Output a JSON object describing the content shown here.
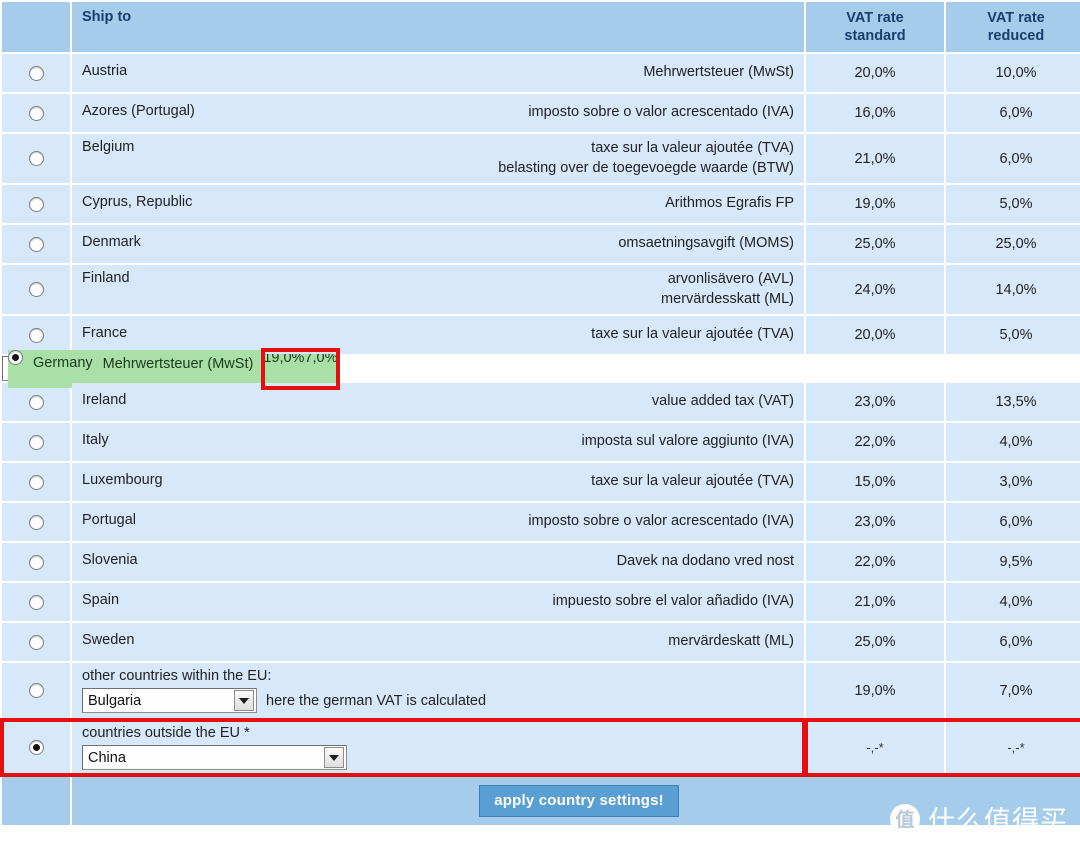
{
  "table": {
    "headers": {
      "radio_col": "",
      "ship_to": "Ship to",
      "vat_standard_line1": "VAT rate",
      "vat_standard_line2": "standard",
      "vat_reduced_line1": "VAT rate",
      "vat_reduced_line2": "reduced"
    },
    "rows": [
      {
        "country": "Austria",
        "tax_names": [
          "Mehrwertsteuer (MwSt)"
        ],
        "vat_standard": "20,0%",
        "vat_reduced": "10,0%",
        "selected": false
      },
      {
        "country": "Azores (Portugal)",
        "tax_names": [
          "imposto sobre o valor acrescentado (IVA)"
        ],
        "vat_standard": "16,0%",
        "vat_reduced": "6,0%",
        "selected": false
      },
      {
        "country": "Belgium",
        "tax_names": [
          "taxe sur la valeur ajoutée (TVA)",
          "belasting over de toegevoegde waarde (BTW)"
        ],
        "vat_standard": "21,0%",
        "vat_reduced": "6,0%",
        "selected": false
      },
      {
        "country": "Cyprus, Republic",
        "tax_names": [
          "Arithmos Egrafis FP"
        ],
        "vat_standard": "19,0%",
        "vat_reduced": "5,0%",
        "selected": false
      },
      {
        "country": "Denmark",
        "tax_names": [
          "omsaetningsavgift (MOMS)"
        ],
        "vat_standard": "25,0%",
        "vat_reduced": "25,0%",
        "selected": false
      },
      {
        "country": "Finland",
        "tax_names": [
          "arvonlisävero (AVL)",
          "mervärdesskatt (ML)"
        ],
        "vat_standard": "24,0%",
        "vat_reduced": "14,0%",
        "selected": false
      },
      {
        "country": "France",
        "tax_names": [
          "taxe sur la valeur ajoutée (TVA)"
        ],
        "vat_standard": "20,0%",
        "vat_reduced": "5,0%",
        "selected": false
      },
      {
        "country": "Germany",
        "tax_names": [
          "Mehrwertsteuer (MwSt)"
        ],
        "vat_standard": "19,0%",
        "vat_reduced": "7,0%",
        "selected": true
      },
      {
        "country": "Ireland",
        "tax_names": [
          "value added tax (VAT)"
        ],
        "vat_standard": "23,0%",
        "vat_reduced": "13,5%",
        "selected": false
      },
      {
        "country": "Italy",
        "tax_names": [
          "imposta sul valore aggiunto (IVA)"
        ],
        "vat_standard": "22,0%",
        "vat_reduced": "4,0%",
        "selected": false
      },
      {
        "country": "Luxembourg",
        "tax_names": [
          "taxe sur la valeur ajoutée (TVA)"
        ],
        "vat_standard": "15,0%",
        "vat_reduced": "3,0%",
        "selected": false
      },
      {
        "country": "Portugal",
        "tax_names": [
          "imposto sobre o valor acrescentado (IVA)"
        ],
        "vat_standard": "23,0%",
        "vat_reduced": "6,0%",
        "selected": false
      },
      {
        "country": "Slovenia",
        "tax_names": [
          "Davek na dodano vred nost"
        ],
        "vat_standard": "22,0%",
        "vat_reduced": "9,5%",
        "selected": false
      },
      {
        "country": "Spain",
        "tax_names": [
          "impuesto sobre el valor añadido (IVA)"
        ],
        "vat_standard": "21,0%",
        "vat_reduced": "4,0%",
        "selected": false
      },
      {
        "country": "Sweden",
        "tax_names": [
          "mervärdeskatt (ML)"
        ],
        "vat_standard": "25,0%",
        "vat_reduced": "6,0%",
        "selected": false
      }
    ],
    "other_eu_row": {
      "label": "other countries within the EU:",
      "select_value": "Bulgaria",
      "note": "here the german VAT is calculated",
      "vat_standard": "19,0%",
      "vat_reduced": "7,0%",
      "selected": false
    },
    "outside_eu_row": {
      "label": "countries outside the EU *",
      "select_value": "China",
      "vat_standard": "-,-*",
      "vat_reduced": "-,-*",
      "selected": true
    }
  },
  "footer": {
    "apply_label": "apply country settings!"
  },
  "watermark": {
    "logo_char": "值",
    "text": "什么值得买"
  },
  "colors": {
    "header_bg": "#a5cdeb",
    "row_bg": "#d6e8fa",
    "selected_row_bg": "#a8e0a8",
    "annotation_red": "#e40f0f",
    "header_text": "#1b3d6b",
    "button_bg": "#5a9fd4"
  }
}
